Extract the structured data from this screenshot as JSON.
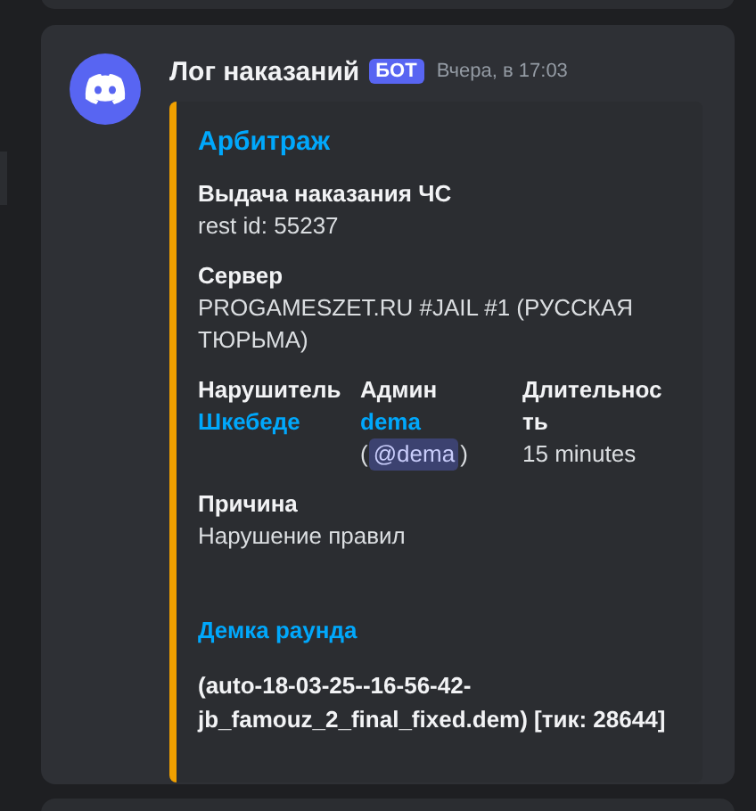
{
  "message": {
    "author": "Лог наказаний",
    "badge": "БОТ",
    "timestamp": "Вчера, в 17:03"
  },
  "embed": {
    "title": "Арбитраж",
    "fields": [
      {
        "name": "Выдача наказания ЧС",
        "value": "rest id: 55237",
        "inline": false,
        "link": false
      },
      {
        "name": "Сервер",
        "value": "PROGAMESZET.RU #JAIL #1 (РУССКАЯ ТЮРЬМА)",
        "inline": false,
        "link": false
      },
      {
        "name": "Нарушитель",
        "value": "Шкебеде",
        "inline": true,
        "link": true
      },
      {
        "name": "Админ",
        "value": "dema",
        "inline": true,
        "link": true,
        "mention_open": "(",
        "mention": "@dema",
        "mention_close": ")"
      },
      {
        "name": "Длительность",
        "value": "15 minutes",
        "inline": true,
        "link": false
      },
      {
        "name": "Причина",
        "value": "Нарушение правил",
        "inline": false,
        "link": false
      }
    ],
    "section_title": "Демка раунда",
    "section_text": "(auto-18-03-25--16-56-42-jb_famouz_2_final_fixed.dem) [тик: 28644]"
  }
}
